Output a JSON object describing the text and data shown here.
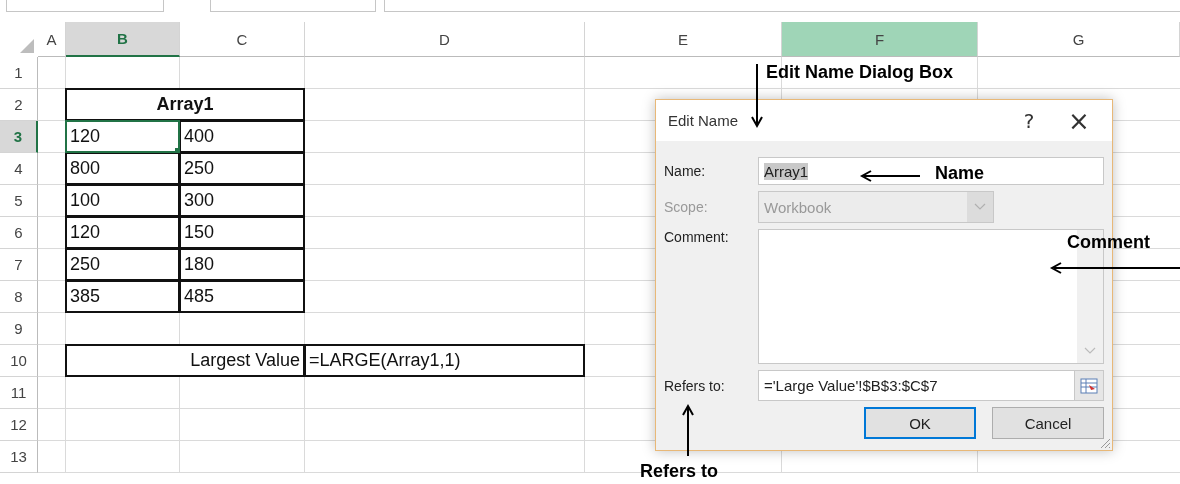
{
  "columns": [
    {
      "label": "A",
      "selected": false,
      "highlighted": false
    },
    {
      "label": "B",
      "selected": true,
      "highlighted": false
    },
    {
      "label": "C",
      "selected": false,
      "highlighted": false
    },
    {
      "label": "D",
      "selected": false,
      "highlighted": false
    },
    {
      "label": "E",
      "selected": false,
      "highlighted": false
    },
    {
      "label": "F",
      "selected": false,
      "highlighted": true
    },
    {
      "label": "G",
      "selected": false,
      "highlighted": false
    }
  ],
  "rows": [
    {
      "label": "1",
      "selected": false
    },
    {
      "label": "2",
      "selected": false
    },
    {
      "label": "3",
      "selected": true
    },
    {
      "label": "4",
      "selected": false
    },
    {
      "label": "5",
      "selected": false
    },
    {
      "label": "6",
      "selected": false
    },
    {
      "label": "7",
      "selected": false
    },
    {
      "label": "8",
      "selected": false
    },
    {
      "label": "9",
      "selected": false
    },
    {
      "label": "10",
      "selected": false
    },
    {
      "label": "11",
      "selected": false
    },
    {
      "label": "12",
      "selected": false
    },
    {
      "label": "13",
      "selected": false
    }
  ],
  "array_table": {
    "title": "Array1",
    "rows": [
      {
        "cells": [
          {
            "text": "120",
            "selected": true
          },
          {
            "text": "400",
            "selected": false
          }
        ]
      },
      {
        "cells": [
          {
            "text": "800",
            "selected": false
          },
          {
            "text": "250",
            "selected": false
          }
        ]
      },
      {
        "cells": [
          {
            "text": "100",
            "selected": false
          },
          {
            "text": "300",
            "selected": false
          }
        ]
      },
      {
        "cells": [
          {
            "text": "120",
            "selected": false
          },
          {
            "text": "150",
            "selected": false
          }
        ]
      },
      {
        "cells": [
          {
            "text": "250",
            "selected": false
          },
          {
            "text": "180",
            "selected": false
          }
        ]
      },
      {
        "cells": [
          {
            "text": "385",
            "selected": false
          },
          {
            "text": "485",
            "selected": false
          }
        ]
      }
    ]
  },
  "result_row": {
    "label": "Largest Value",
    "formula": "=LARGE(Array1,1)"
  },
  "dialog": {
    "title": "Edit Name",
    "help": "?",
    "close": "×",
    "name": {
      "label": "Name:",
      "value": "Array1",
      "text_selected": true
    },
    "scope": {
      "label": "Scope:",
      "value": "Workbook",
      "disabled": true
    },
    "comment": {
      "label": "Comment:"
    },
    "refers_to": {
      "label": "Refers to:",
      "value": "='Large Value'!$B$3:$C$7"
    },
    "buttons": [
      {
        "label": "OK",
        "default": true
      },
      {
        "label": "Cancel",
        "default": false
      }
    ]
  },
  "annotations": [
    {
      "text": "Edit Name Dialog Box",
      "kind": "down"
    },
    {
      "text": "Name",
      "kind": "left"
    },
    {
      "text": "Comment",
      "kind": "left"
    },
    {
      "text": "Refers to",
      "kind": "up"
    }
  ]
}
